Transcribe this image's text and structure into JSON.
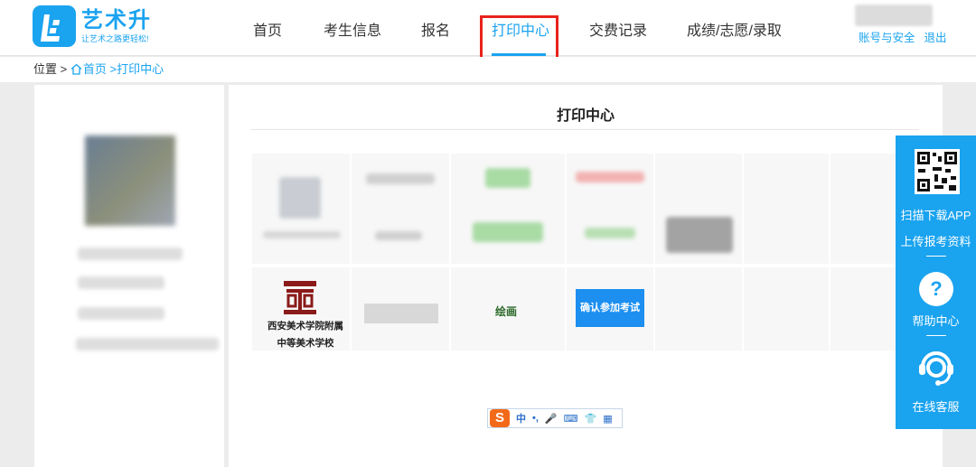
{
  "brand": {
    "name": "艺术升",
    "slogan": "让艺术之路更轻松!",
    "color": "#1aa3ef"
  },
  "nav": {
    "items": [
      {
        "label": "首页"
      },
      {
        "label": "考生信息"
      },
      {
        "label": "报名"
      },
      {
        "label": "打印中心",
        "active": true
      },
      {
        "label": "交费记录"
      },
      {
        "label": "成绩/志愿/录取"
      }
    ],
    "highlight_color": "#e8231c"
  },
  "user": {
    "account_link": "账号与安全",
    "logout_link": "退出"
  },
  "breadcrumb": {
    "prefix": "位置",
    "separator": ">",
    "home": "首页",
    "current": ">打印中心"
  },
  "main": {
    "title": "打印中心",
    "row": {
      "school_name_line1": "西安美术学院附属",
      "school_name_line2": "中等美术学校",
      "subject": "绘画",
      "action_label": "确认参加考试"
    }
  },
  "ime_toolbar": {
    "logo": "S",
    "items": [
      "中",
      "•,",
      "🎤",
      "⌨",
      "👕",
      "▦"
    ]
  },
  "float_bar": {
    "scan_label": "扫描下载APP",
    "upload_label": "上传报考资料",
    "help_symbol": "?",
    "help_label": "帮助中心",
    "service_label": "在线客服"
  }
}
